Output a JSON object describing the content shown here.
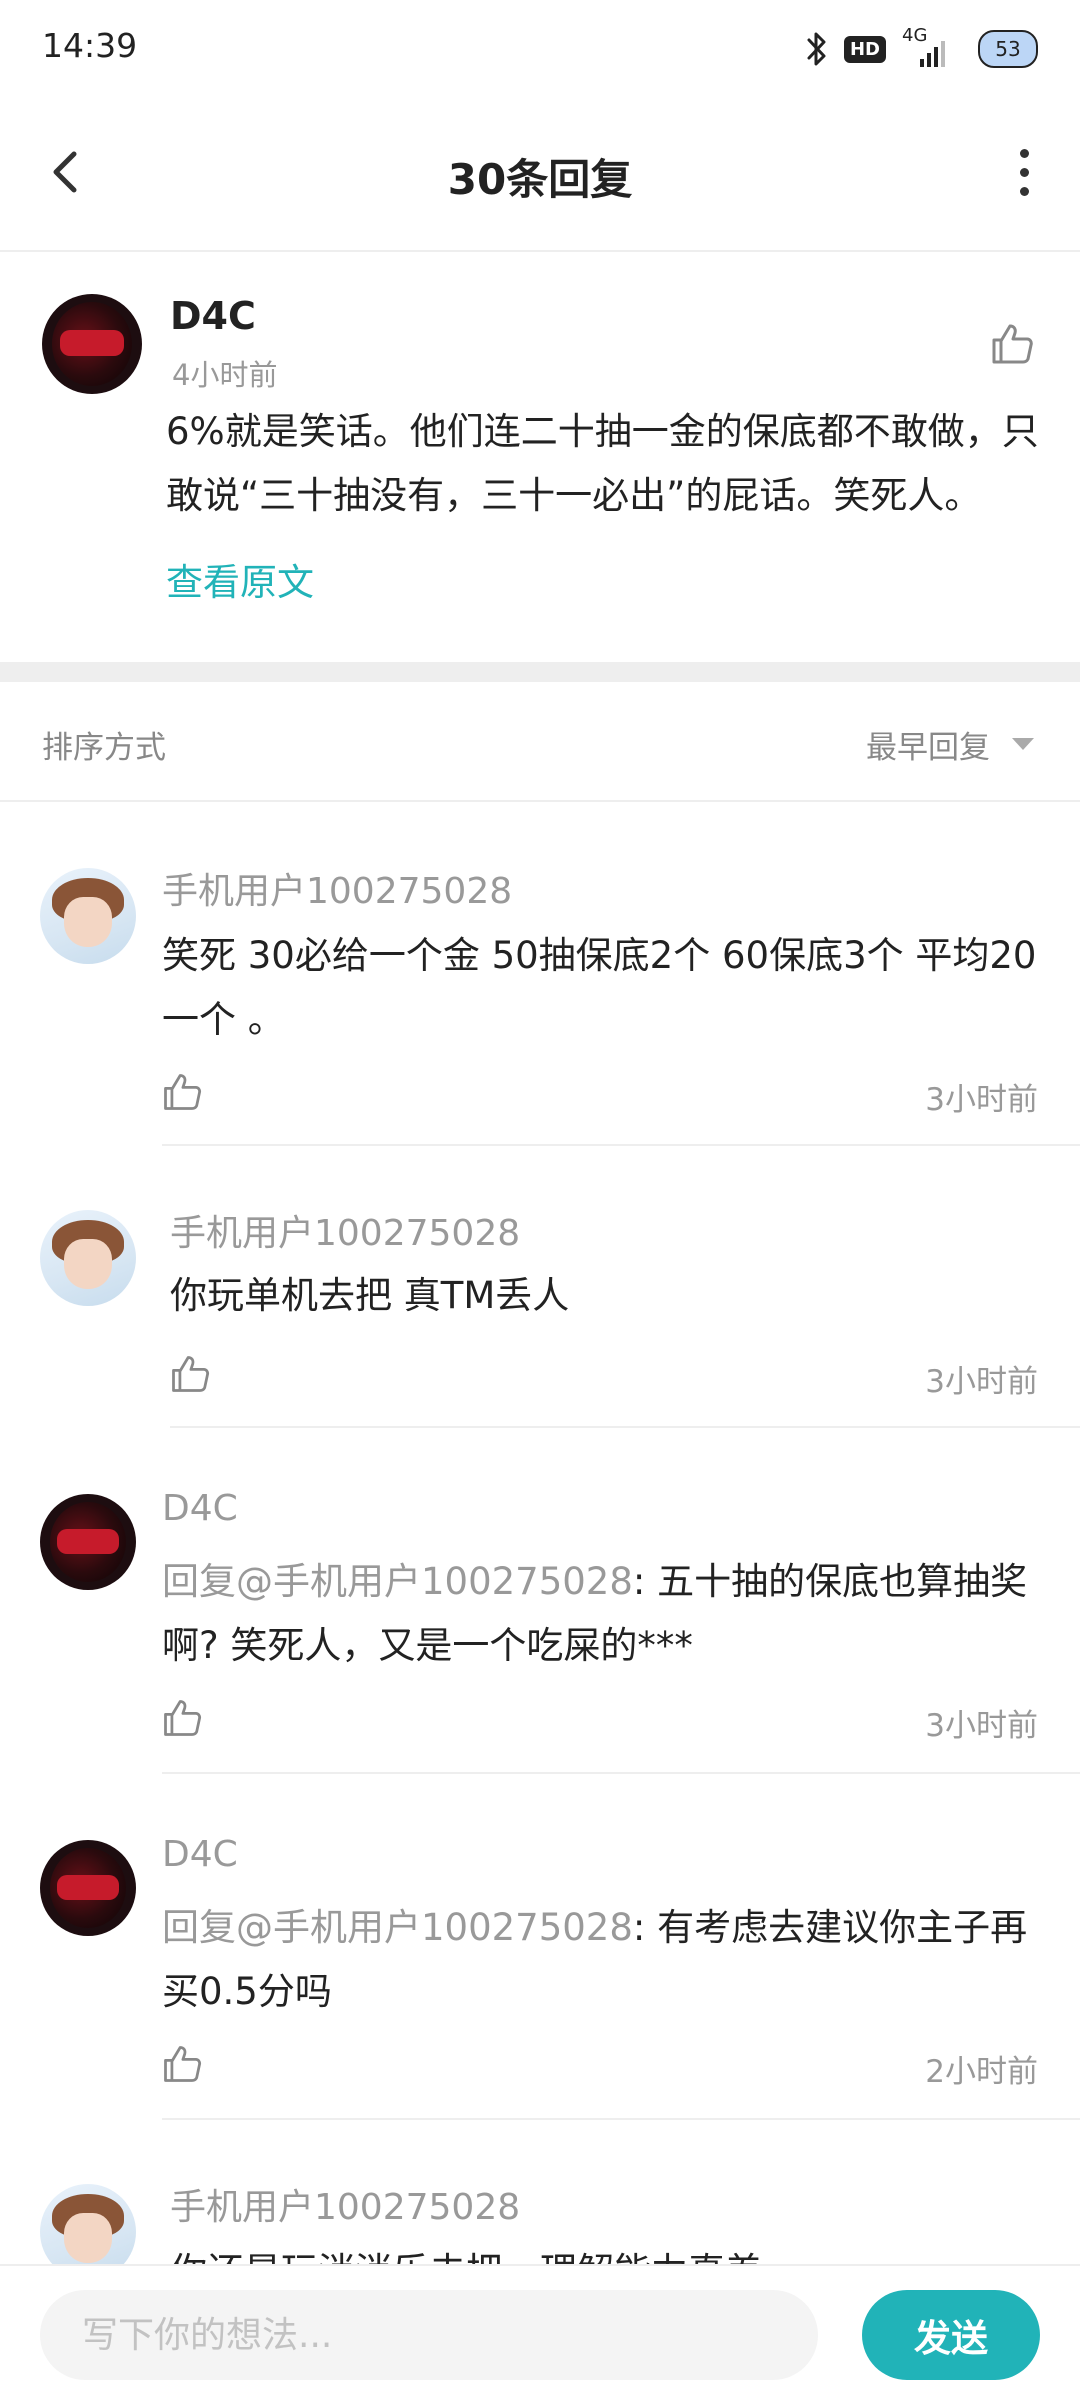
{
  "status_bar": {
    "time": "14:39",
    "network_label": "4G",
    "hd_label": "HD",
    "battery_level": "53",
    "icons": [
      "bluetooth-icon",
      "hd-icon",
      "signal-icon",
      "battery-icon"
    ]
  },
  "header": {
    "title": "30条回复",
    "back_icon": "chevron-left-icon",
    "more_icon": "more-vertical-icon"
  },
  "main_post": {
    "author": "D4C",
    "time": "4小时前",
    "text": "6%就是笑话。他们连二十抽一金的保底都不敢做，只敢说“三十抽没有，三十一必出”的屁话。笑死人。",
    "view_original_label": "查看原文",
    "like_icon": "thumbs-up-icon"
  },
  "sort": {
    "label": "排序方式",
    "value": "最早回复",
    "caret_icon": "caret-down-icon"
  },
  "replies": [
    {
      "author": "手机用户100275028",
      "mention": "",
      "text": "笑死 30必给一个金 50抽保底2个 60保底3个 平均20一个 。",
      "time": "3小时前"
    },
    {
      "author": "手机用户100275028",
      "mention": "",
      "text": "你玩单机去把 真TM丢人",
      "time": "3小时前"
    },
    {
      "author": "D4C",
      "mention": "回复@手机用户100275028",
      "text": ": 五十抽的保底也算抽奖啊? 笑死人，又是一个吃屎的***",
      "time": "3小时前"
    },
    {
      "author": "D4C",
      "mention": "回复@手机用户100275028",
      "text": ": 有考虑去建议你主子再买0.5分吗",
      "time": "2小时前"
    },
    {
      "author": "手机用户100275028",
      "mention": "",
      "text": "你还是玩消消乐去把，理解能力真差",
      "time": ""
    }
  ],
  "input_bar": {
    "placeholder": "写下你的想法...",
    "send_label": "发送"
  },
  "colors": {
    "accent": "#21b3b8",
    "muted_text": "#999999",
    "divider": "#eeeeee"
  }
}
